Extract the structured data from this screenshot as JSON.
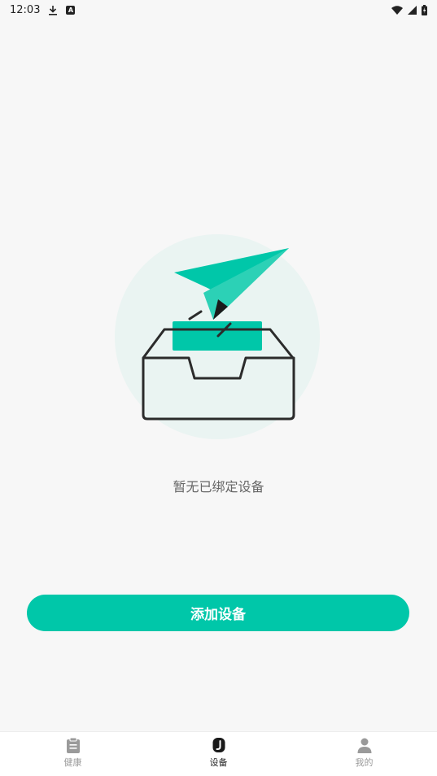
{
  "status_bar": {
    "time": "12:03",
    "left_icons": [
      "download-icon",
      "text-badge-icon"
    ],
    "text_badge": "A",
    "right_icons": [
      "wifi-icon",
      "signal-icon",
      "battery-icon"
    ]
  },
  "main": {
    "empty_message": "暂无已绑定设备",
    "illustration_icon": "paper-plane-inbox-illustration",
    "add_button_label": "添加设备"
  },
  "bottom_nav": {
    "items": [
      {
        "label": "健康",
        "icon": "clipboard-icon",
        "active": false
      },
      {
        "label": "设备",
        "icon": "watch-icon",
        "active": true
      },
      {
        "label": "我的",
        "icon": "person-icon",
        "active": false
      }
    ]
  },
  "colors": {
    "accent": "#00c7a9",
    "background": "#f7f7f7",
    "inactive_nav": "#9a9a9a",
    "active_nav": "#222222"
  }
}
